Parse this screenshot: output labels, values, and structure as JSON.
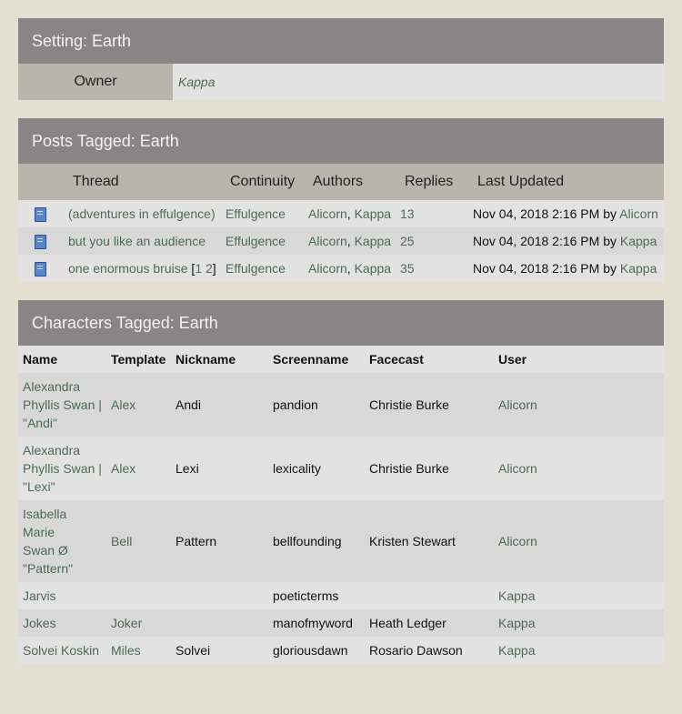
{
  "setting": {
    "title": "Setting: Earth",
    "owner_label": "Owner",
    "owner_value": "Kappa"
  },
  "posts": {
    "title": "Posts Tagged: Earth",
    "headers": {
      "thread": "Thread",
      "continuity": "Continuity",
      "authors": "Authors",
      "replies": "Replies",
      "last_updated": "Last Updated"
    },
    "rows": [
      {
        "thread": "(adventures in effulgence)",
        "continuity": "Effulgence",
        "author1": "Alicorn",
        "sep": ",",
        "author2": "Kappa",
        "replies": "13",
        "updated": "Nov 04, 2018 2:16 PM by",
        "updated_by": "Alicorn"
      },
      {
        "thread": "but you like an audience",
        "continuity": "Effulgence",
        "author1": "Alicorn",
        "sep": ",",
        "author2": "Kappa",
        "replies": "25",
        "updated": "Nov 04, 2018 2:16 PM by",
        "updated_by": "Kappa"
      },
      {
        "thread": "one enormous bruise",
        "pages_open": "[",
        "page1": "1",
        "page2": "2",
        "pages_close": "]",
        "continuity": "Effulgence",
        "author1": "Alicorn",
        "sep": ",",
        "author2": "Kappa",
        "replies": "35",
        "updated": "Nov 04, 2018 2:16 PM by",
        "updated_by": "Kappa"
      }
    ],
    "icon": "book-icon"
  },
  "characters": {
    "title": "Characters Tagged: Earth",
    "headers": [
      "Name",
      "Template",
      "Nickname",
      "Screenname",
      "Facecast",
      "User"
    ],
    "rows": [
      {
        "name_lines": [
          "Alexandra",
          "Phyllis Swan |",
          "\"Andi\""
        ],
        "template": "Alex",
        "nickname": "Andi",
        "screenname": "pandion",
        "facecast": "Christie Burke",
        "user": "Alicorn"
      },
      {
        "name_lines": [
          "Alexandra",
          "Phyllis Swan |",
          "\"Lexi\""
        ],
        "template": "Alex",
        "nickname": "Lexi",
        "screenname": "lexicality",
        "facecast": "Christie Burke",
        "user": "Alicorn"
      },
      {
        "name_lines": [
          "Isabella Marie",
          "Swan Ø",
          "\"Pattern\""
        ],
        "template": "Bell",
        "nickname": "Pattern",
        "screenname": "bellfounding",
        "facecast": "Kristen Stewart",
        "user": "Alicorn"
      },
      {
        "name_lines": [
          "Jarvis"
        ],
        "template": "",
        "nickname": "",
        "screenname": "poeticterms",
        "facecast": "",
        "user": "Kappa"
      },
      {
        "name_lines": [
          "Jokes"
        ],
        "template": "Joker",
        "nickname": "",
        "screenname": "manofmyword",
        "facecast": "Heath Ledger",
        "user": "Kappa"
      },
      {
        "name_lines": [
          "Solvei Koskin"
        ],
        "template": "Miles",
        "nickname": "Solvei",
        "screenname": "gloriousdawn",
        "facecast": "Rosario Dawson",
        "user": "Kappa"
      }
    ]
  },
  "colors": {
    "background": "#e5dfd2",
    "header": "#8a8486",
    "subheader": "#b8b5ad",
    "link": "#4b6b54"
  }
}
